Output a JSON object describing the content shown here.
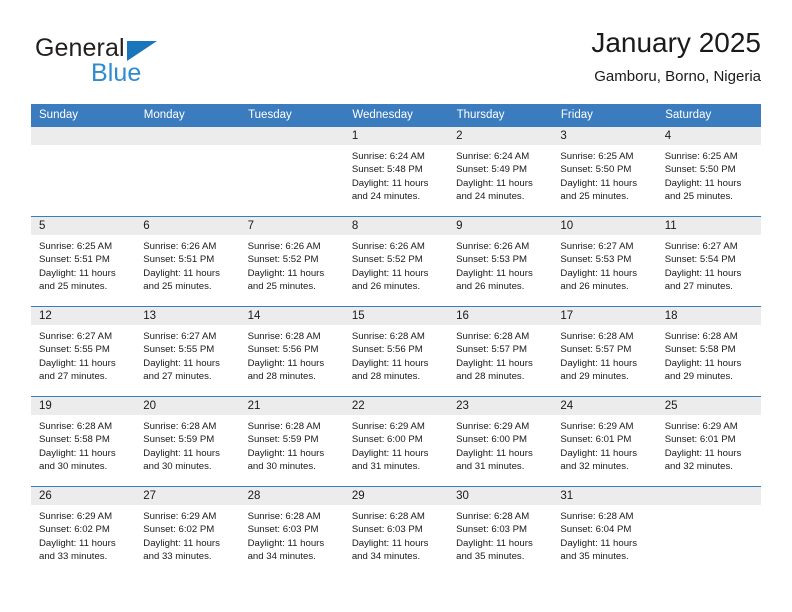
{
  "brand": {
    "name_part1": "General",
    "name_part2": "Blue",
    "triangle_color": "#1b75bb",
    "blue_text_color": "#2e8bd0"
  },
  "header": {
    "title": "January 2025",
    "subtitle": "Gamboru, Borno, Nigeria"
  },
  "colors": {
    "header_blue": "#3a7cbd",
    "daynum_band": "#ececec",
    "text": "#1a1a1a"
  },
  "weekdays": [
    "Sunday",
    "Monday",
    "Tuesday",
    "Wednesday",
    "Thursday",
    "Friday",
    "Saturday"
  ],
  "labels": {
    "sunrise_prefix": "Sunrise:",
    "sunset_prefix": "Sunset:",
    "daylight_prefix": "Daylight:"
  },
  "weeks": [
    [
      {
        "day": "",
        "sunrise": "",
        "sunset": "",
        "daylight": ""
      },
      {
        "day": "",
        "sunrise": "",
        "sunset": "",
        "daylight": ""
      },
      {
        "day": "",
        "sunrise": "",
        "sunset": "",
        "daylight": ""
      },
      {
        "day": "1",
        "sunrise": "Sunrise: 6:24 AM",
        "sunset": "Sunset: 5:48 PM",
        "daylight": "Daylight: 11 hours and 24 minutes."
      },
      {
        "day": "2",
        "sunrise": "Sunrise: 6:24 AM",
        "sunset": "Sunset: 5:49 PM",
        "daylight": "Daylight: 11 hours and 24 minutes."
      },
      {
        "day": "3",
        "sunrise": "Sunrise: 6:25 AM",
        "sunset": "Sunset: 5:50 PM",
        "daylight": "Daylight: 11 hours and 25 minutes."
      },
      {
        "day": "4",
        "sunrise": "Sunrise: 6:25 AM",
        "sunset": "Sunset: 5:50 PM",
        "daylight": "Daylight: 11 hours and 25 minutes."
      }
    ],
    [
      {
        "day": "5",
        "sunrise": "Sunrise: 6:25 AM",
        "sunset": "Sunset: 5:51 PM",
        "daylight": "Daylight: 11 hours and 25 minutes."
      },
      {
        "day": "6",
        "sunrise": "Sunrise: 6:26 AM",
        "sunset": "Sunset: 5:51 PM",
        "daylight": "Daylight: 11 hours and 25 minutes."
      },
      {
        "day": "7",
        "sunrise": "Sunrise: 6:26 AM",
        "sunset": "Sunset: 5:52 PM",
        "daylight": "Daylight: 11 hours and 25 minutes."
      },
      {
        "day": "8",
        "sunrise": "Sunrise: 6:26 AM",
        "sunset": "Sunset: 5:52 PM",
        "daylight": "Daylight: 11 hours and 26 minutes."
      },
      {
        "day": "9",
        "sunrise": "Sunrise: 6:26 AM",
        "sunset": "Sunset: 5:53 PM",
        "daylight": "Daylight: 11 hours and 26 minutes."
      },
      {
        "day": "10",
        "sunrise": "Sunrise: 6:27 AM",
        "sunset": "Sunset: 5:53 PM",
        "daylight": "Daylight: 11 hours and 26 minutes."
      },
      {
        "day": "11",
        "sunrise": "Sunrise: 6:27 AM",
        "sunset": "Sunset: 5:54 PM",
        "daylight": "Daylight: 11 hours and 27 minutes."
      }
    ],
    [
      {
        "day": "12",
        "sunrise": "Sunrise: 6:27 AM",
        "sunset": "Sunset: 5:55 PM",
        "daylight": "Daylight: 11 hours and 27 minutes."
      },
      {
        "day": "13",
        "sunrise": "Sunrise: 6:27 AM",
        "sunset": "Sunset: 5:55 PM",
        "daylight": "Daylight: 11 hours and 27 minutes."
      },
      {
        "day": "14",
        "sunrise": "Sunrise: 6:28 AM",
        "sunset": "Sunset: 5:56 PM",
        "daylight": "Daylight: 11 hours and 28 minutes."
      },
      {
        "day": "15",
        "sunrise": "Sunrise: 6:28 AM",
        "sunset": "Sunset: 5:56 PM",
        "daylight": "Daylight: 11 hours and 28 minutes."
      },
      {
        "day": "16",
        "sunrise": "Sunrise: 6:28 AM",
        "sunset": "Sunset: 5:57 PM",
        "daylight": "Daylight: 11 hours and 28 minutes."
      },
      {
        "day": "17",
        "sunrise": "Sunrise: 6:28 AM",
        "sunset": "Sunset: 5:57 PM",
        "daylight": "Daylight: 11 hours and 29 minutes."
      },
      {
        "day": "18",
        "sunrise": "Sunrise: 6:28 AM",
        "sunset": "Sunset: 5:58 PM",
        "daylight": "Daylight: 11 hours and 29 minutes."
      }
    ],
    [
      {
        "day": "19",
        "sunrise": "Sunrise: 6:28 AM",
        "sunset": "Sunset: 5:58 PM",
        "daylight": "Daylight: 11 hours and 30 minutes."
      },
      {
        "day": "20",
        "sunrise": "Sunrise: 6:28 AM",
        "sunset": "Sunset: 5:59 PM",
        "daylight": "Daylight: 11 hours and 30 minutes."
      },
      {
        "day": "21",
        "sunrise": "Sunrise: 6:28 AM",
        "sunset": "Sunset: 5:59 PM",
        "daylight": "Daylight: 11 hours and 30 minutes."
      },
      {
        "day": "22",
        "sunrise": "Sunrise: 6:29 AM",
        "sunset": "Sunset: 6:00 PM",
        "daylight": "Daylight: 11 hours and 31 minutes."
      },
      {
        "day": "23",
        "sunrise": "Sunrise: 6:29 AM",
        "sunset": "Sunset: 6:00 PM",
        "daylight": "Daylight: 11 hours and 31 minutes."
      },
      {
        "day": "24",
        "sunrise": "Sunrise: 6:29 AM",
        "sunset": "Sunset: 6:01 PM",
        "daylight": "Daylight: 11 hours and 32 minutes."
      },
      {
        "day": "25",
        "sunrise": "Sunrise: 6:29 AM",
        "sunset": "Sunset: 6:01 PM",
        "daylight": "Daylight: 11 hours and 32 minutes."
      }
    ],
    [
      {
        "day": "26",
        "sunrise": "Sunrise: 6:29 AM",
        "sunset": "Sunset: 6:02 PM",
        "daylight": "Daylight: 11 hours and 33 minutes."
      },
      {
        "day": "27",
        "sunrise": "Sunrise: 6:29 AM",
        "sunset": "Sunset: 6:02 PM",
        "daylight": "Daylight: 11 hours and 33 minutes."
      },
      {
        "day": "28",
        "sunrise": "Sunrise: 6:28 AM",
        "sunset": "Sunset: 6:03 PM",
        "daylight": "Daylight: 11 hours and 34 minutes."
      },
      {
        "day": "29",
        "sunrise": "Sunrise: 6:28 AM",
        "sunset": "Sunset: 6:03 PM",
        "daylight": "Daylight: 11 hours and 34 minutes."
      },
      {
        "day": "30",
        "sunrise": "Sunrise: 6:28 AM",
        "sunset": "Sunset: 6:03 PM",
        "daylight": "Daylight: 11 hours and 35 minutes."
      },
      {
        "day": "31",
        "sunrise": "Sunrise: 6:28 AM",
        "sunset": "Sunset: 6:04 PM",
        "daylight": "Daylight: 11 hours and 35 minutes."
      },
      {
        "day": "",
        "sunrise": "",
        "sunset": "",
        "daylight": ""
      }
    ]
  ]
}
